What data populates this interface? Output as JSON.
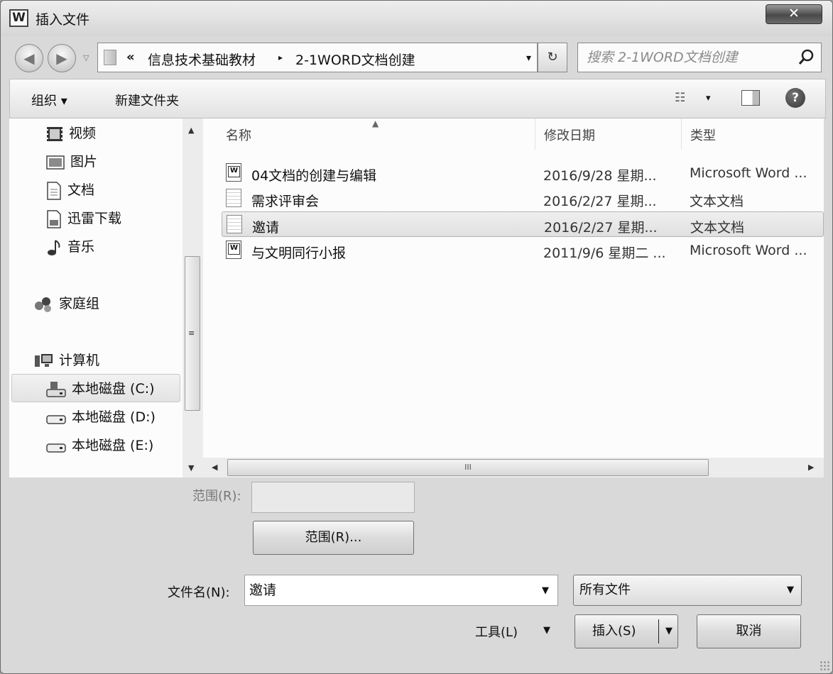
{
  "window": {
    "title": "插入文件",
    "app_icon_letter": "W",
    "close_glyph": "✕"
  },
  "address_bar": {
    "overflow_glyph": "«",
    "breadcrumbs": [
      "信息技术基础教材",
      "2-1WORD文档创建"
    ],
    "separator_glyph": "▸",
    "dropdown_glyph": "▾",
    "refresh_glyph": "↻",
    "search_placeholder": "搜索 2-1WORD文档创建"
  },
  "toolbar": {
    "organize_label": "组织 ▾",
    "new_folder_label": "新建文件夹",
    "views_glyph": "☷",
    "views_arrow": "▾",
    "help_glyph": "?"
  },
  "nav_pane": {
    "items": [
      {
        "label": "视频",
        "icon": "video-icon"
      },
      {
        "label": "图片",
        "icon": "pictures-icon"
      },
      {
        "label": "文档",
        "icon": "documents-icon"
      },
      {
        "label": "迅雷下载",
        "icon": "download-icon"
      },
      {
        "label": "音乐",
        "icon": "music-icon"
      },
      {
        "label": "家庭组",
        "icon": "homegroup-icon"
      },
      {
        "label": "计算机",
        "icon": "computer-icon"
      },
      {
        "label": "本地磁盘 (C:)",
        "icon": "drive-c-icon"
      },
      {
        "label": "本地磁盘 (D:)",
        "icon": "drive-icon"
      },
      {
        "label": "本地磁盘 (E:)",
        "icon": "drive-icon"
      }
    ],
    "selected_index": 7
  },
  "file_list": {
    "columns": [
      "名称",
      "修改日期",
      "类型"
    ],
    "rows": [
      {
        "name": "04文档的创建与编辑",
        "date": "2016/9/28 星期...",
        "type": "Microsoft Word ...",
        "icon": "word-doc-icon"
      },
      {
        "name": "需求评审会",
        "date": "2016/2/27 星期...",
        "type": "文本文档",
        "icon": "text-file-icon"
      },
      {
        "name": "邀请",
        "date": "2016/2/27 星期...",
        "type": "文本文档",
        "icon": "text-file-icon"
      },
      {
        "name": "与文明同行小报",
        "date": "2011/9/6 星期二 ...",
        "type": "Microsoft Word ...",
        "icon": "word-doc-icon"
      }
    ],
    "selected_row": 2,
    "hscroll_grip": "III"
  },
  "bottom": {
    "range_label": "范围(R):",
    "range_button": "范围(R)...",
    "filename_label": "文件名(N):",
    "filename_value": "邀请",
    "filetype_value": "所有文件",
    "tools_label": "工具(L)",
    "insert_label": "插入(S)",
    "cancel_label": "取消"
  }
}
